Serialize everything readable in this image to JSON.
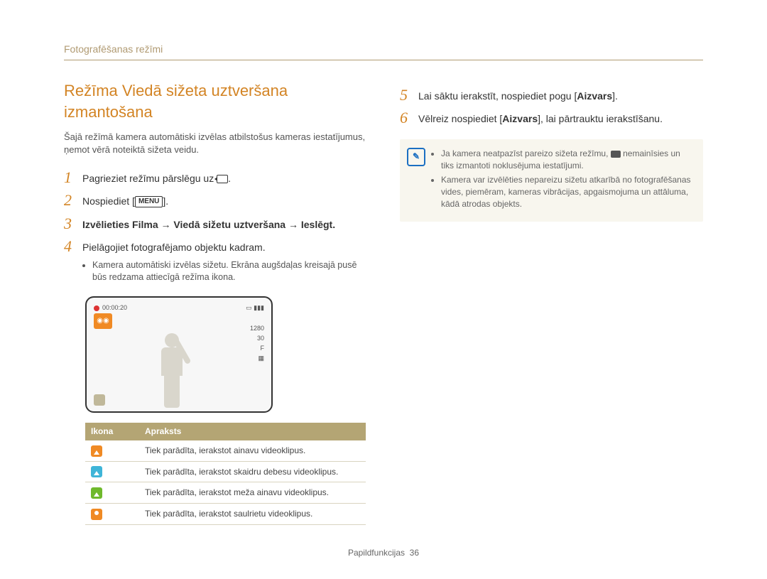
{
  "breadcrumb": "Fotografēšanas režīmi",
  "title": "Režīma Viedā sižeta uztveršana izmantošana",
  "intro": "Šajā režīmā kamera automātiski izvēlas atbilstošus kameras iestatījumus, ņemot vērā noteiktā sižeta veidu.",
  "steps": {
    "s1": "Pagrieziet režīmu pārslēgu uz ",
    "s2_a": "Nospiediet [",
    "s2_menu": "MENU",
    "s2_b": "].",
    "s3": "Izvēlieties Filma → Viedā sižetu uztveršana → Ieslēgt.",
    "s4": "Pielāgojiet fotografējamo objektu kadram.",
    "s4_bullet": "Kamera automātiski izvēlas sižetu. Ekrāna augšdaļas kreisajā pusē būs redzama attiecīgā režīma ikona.",
    "s5_a": "Lai sāktu ierakstīt, nospiediet pogu [",
    "s5_b": "Aizvars",
    "s5_c": "].",
    "s6_a": "Vēlreiz nospiediet [",
    "s6_b": "Aizvars",
    "s6_c": "], lai pārtrauktu ierakstīšanu."
  },
  "preview": {
    "timer": "00:00:20"
  },
  "table": {
    "h1": "Ikona",
    "h2": "Apraksts",
    "rows": [
      {
        "desc": "Tiek parādīta, ierakstot ainavu videoklipus.",
        "color": "orange"
      },
      {
        "desc": "Tiek parādīta, ierakstot skaidru debesu videoklipus.",
        "color": "blue"
      },
      {
        "desc": "Tiek parādīta, ierakstot meža ainavu videoklipus.",
        "color": "green"
      },
      {
        "desc": "Tiek parādīta, ierakstot saulrietu videoklipus.",
        "color": "sunset"
      }
    ]
  },
  "note": {
    "n1_a": "Ja kamera neatpazīst pareizo sižeta režīmu, ",
    "n1_b": " nemainīsies un tiks izmantoti noklusējuma iestatījumi.",
    "n2": "Kamera var izvēlēties nepareizu sižetu atkarībā no fotografēšanas vides, piemēram, kameras vibrācijas, apgaismojuma un attāluma, kādā atrodas objekts."
  },
  "footer": {
    "label": "Papildfunkcijas",
    "page": "36"
  }
}
